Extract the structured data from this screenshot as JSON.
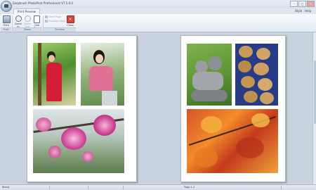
{
  "window": {
    "title": "Easybrush PhotoPrint Professional V7.5.0.0",
    "right_menu": [
      "Style",
      "Help"
    ]
  },
  "tabs": {
    "active": "Print Preview"
  },
  "ribbon": {
    "buttons": [
      {
        "label": "Print",
        "icon": "printer-icon",
        "enabled": true
      },
      {
        "label": "Zoom In",
        "icon": "zoom-in-icon",
        "enabled": true
      },
      {
        "label": "Zoom Out",
        "icon": "zoom-out-icon",
        "enabled": false
      },
      {
        "label": "One Page",
        "icon": "one-page-icon",
        "enabled": true
      },
      {
        "label": "Next Page",
        "icon": "next-page-icon",
        "enabled": false
      },
      {
        "label": "Previous Page",
        "icon": "previous-page-icon",
        "enabled": false
      },
      {
        "label": "Close",
        "icon": "close-preview-icon",
        "enabled": true
      }
    ],
    "groups": [
      "Print",
      "Zoom",
      "Preview"
    ]
  },
  "pages": [
    {
      "photos": [
        "woman-by-tree",
        "woman-pink-top",
        "pink-flowers"
      ]
    },
    {
      "photos": [
        "gray-kittens",
        "golden-puppies",
        "autumn-leaves"
      ]
    }
  ],
  "status": {
    "left": "Ready",
    "center": "Page 1-2"
  }
}
